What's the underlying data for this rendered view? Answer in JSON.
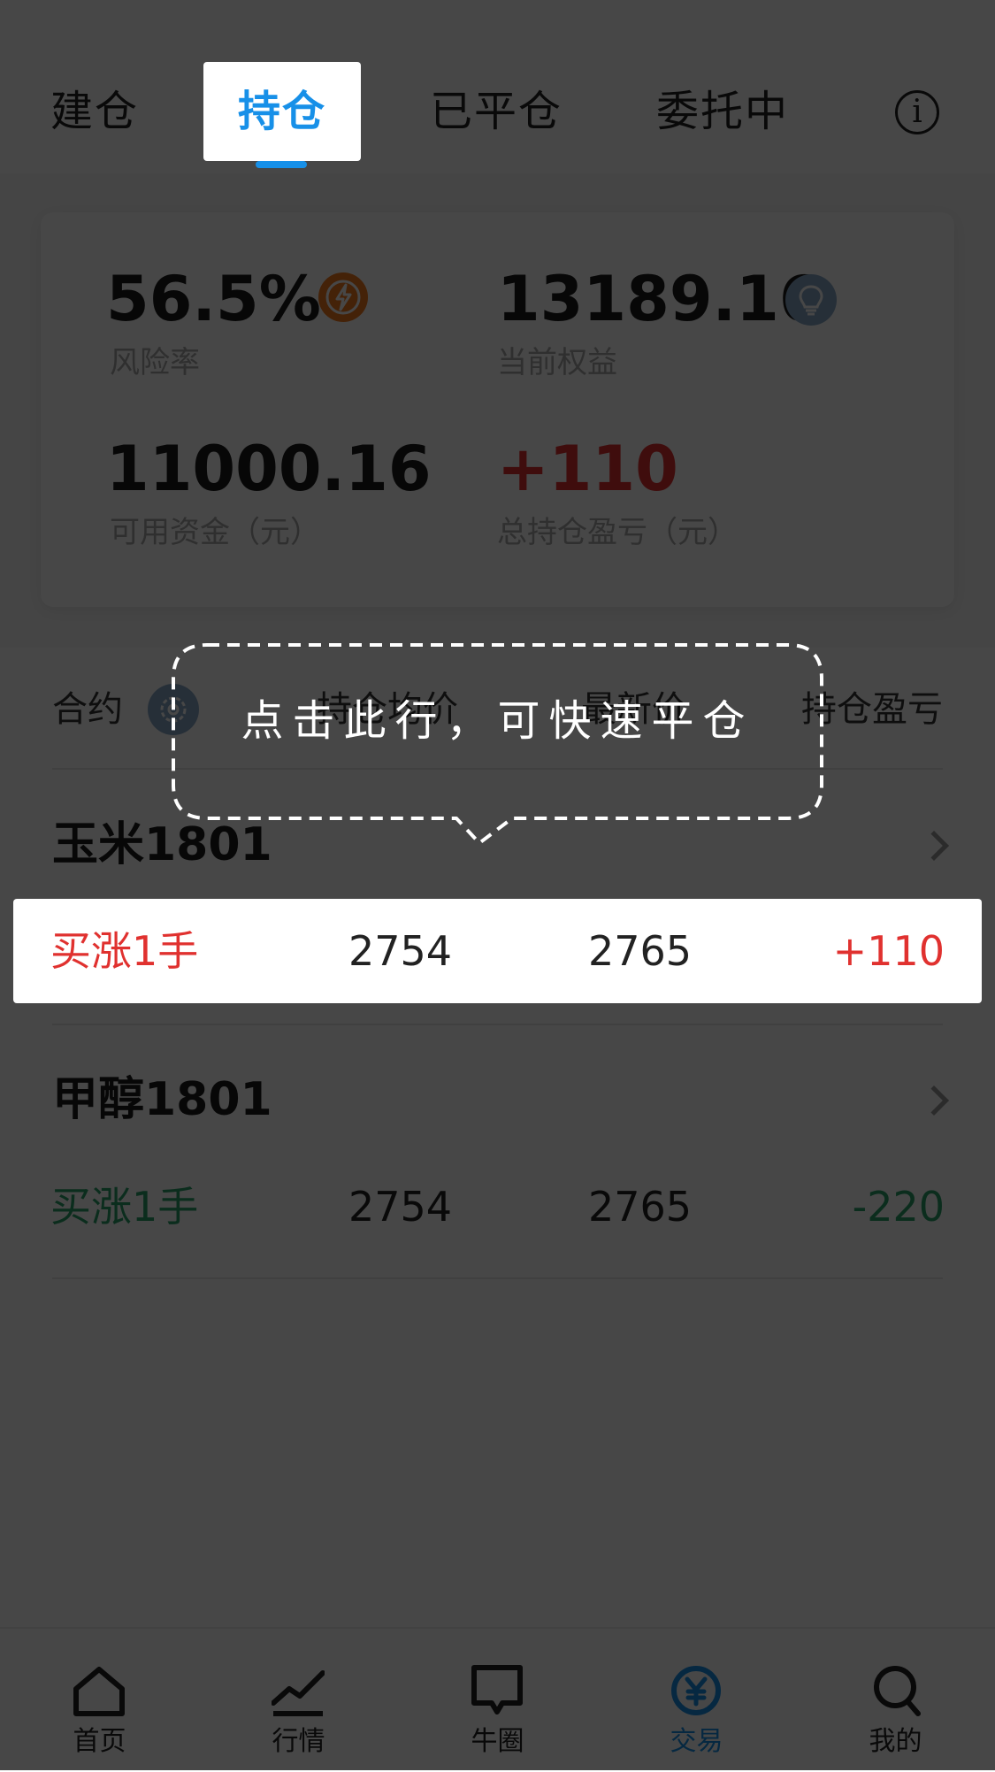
{
  "tabs": {
    "build": "建仓",
    "hold": "持仓",
    "closed": "已平仓",
    "pending": "委托中",
    "info_icon": "i"
  },
  "summary": {
    "risk_value": "56.5%",
    "risk_label": "风险率",
    "equity_value": "13189.16",
    "equity_label": "当前权益",
    "available_value": "11000.16",
    "available_label": "可用资金（元）",
    "pnl_value": "+110",
    "pnl_label": "总持仓盈亏（元）"
  },
  "table": {
    "headers": {
      "contract": "合约",
      "avg_price": "持仓均价",
      "last_price": "最新价",
      "pnl": "持仓盈亏"
    },
    "positions": [
      {
        "name": "玉米1801",
        "side": "买涨1手",
        "avg": "2754",
        "last": "2765",
        "pnl": "+110"
      },
      {
        "name": "甲醇1801",
        "side": "买涨1手",
        "avg": "2754",
        "last": "2765",
        "pnl": "-220"
      }
    ]
  },
  "tooltip": {
    "text": "点击此行，可快速平仓"
  },
  "nav": {
    "home": "首页",
    "market": "行情",
    "circle": "牛圈",
    "trade": "交易",
    "mine": "我的"
  },
  "colors": {
    "accent": "#1790e8",
    "up": "#e0312f",
    "down": "#2aa06a",
    "badge_orange": "#f47a1f",
    "badge_blue": "#8aa9c8"
  },
  "icons": {
    "risk": "lightning-icon",
    "equity": "lightbulb-icon",
    "settings": "gear-icon",
    "row_arrow": "chevron-right-icon"
  }
}
